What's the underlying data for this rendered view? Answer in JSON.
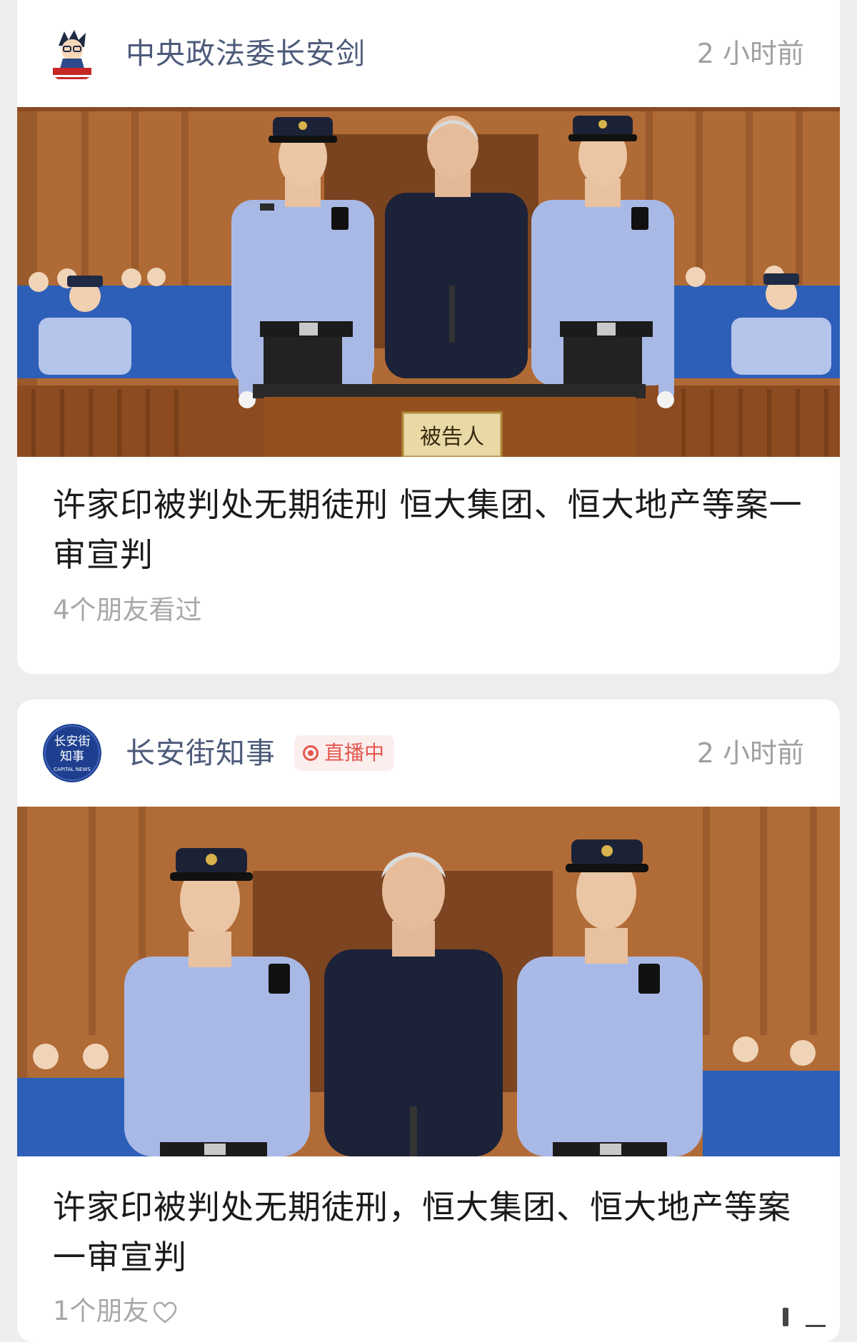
{
  "feed": {
    "cards": [
      {
        "account_name": "中央政法委长安剑",
        "avatar_icon": "changanjian-logo-icon",
        "time": "2 小时前",
        "image_sign": "被告人",
        "headline": "许家印被判处无期徒刑 恒大集团、恒大地产等案一审宣判",
        "friends_text": "4个朋友看过"
      },
      {
        "account_name": "长安街知事",
        "avatar_icon": "changanjie-zhishi-logo-icon",
        "avatar_text_line1": "长安街",
        "avatar_text_line2": "知事",
        "avatar_text_line3": "CAPITAL NEWS",
        "live_badge": "直播中",
        "time": "2 小时前",
        "headline": "许家印被判处无期徒刑，恒大集团、恒大地产等案一审宣判",
        "friends_text": "1个朋友"
      }
    ]
  },
  "colors": {
    "page_background": "#ededed",
    "account_name": "#4d5b7a",
    "live_badge": "#e2574c",
    "secondary_text": "#a0a0a0"
  }
}
